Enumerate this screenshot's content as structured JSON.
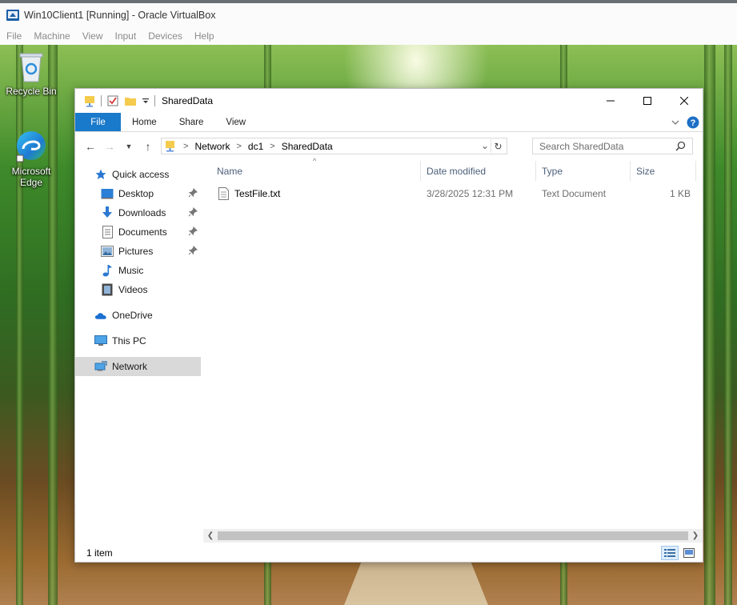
{
  "vbox": {
    "title": "Win10Client1 [Running] - Oracle VirtualBox",
    "menu": [
      "File",
      "Machine",
      "View",
      "Input",
      "Devices",
      "Help"
    ]
  },
  "desktop": {
    "icons": [
      {
        "label": "Recycle Bin",
        "icon": "recycle-bin-icon"
      },
      {
        "label": "Microsoft Edge",
        "icon": "edge-icon"
      }
    ]
  },
  "explorer": {
    "title": "SharedData",
    "ribbon_tabs": [
      "File",
      "Home",
      "Share",
      "View"
    ],
    "breadcrumb": [
      "Network",
      "dc1",
      "SharedData"
    ],
    "search_placeholder": "Search SharedData",
    "nav": {
      "quick_access": "Quick access",
      "quick_items": [
        {
          "label": "Desktop",
          "icon": "desktop-icon",
          "pinned": true
        },
        {
          "label": "Downloads",
          "icon": "downloads-icon",
          "pinned": true
        },
        {
          "label": "Documents",
          "icon": "documents-icon",
          "pinned": true
        },
        {
          "label": "Pictures",
          "icon": "pictures-icon",
          "pinned": true
        },
        {
          "label": "Music",
          "icon": "music-icon",
          "pinned": false
        },
        {
          "label": "Videos",
          "icon": "videos-icon",
          "pinned": false
        }
      ],
      "onedrive": "OneDrive",
      "this_pc": "This PC",
      "network": "Network",
      "selected": "Network"
    },
    "columns": [
      "Name",
      "Date modified",
      "Type",
      "Size"
    ],
    "files": [
      {
        "name": "TestFile.txt",
        "date_modified": "3/28/2025 12:31 PM",
        "type": "Text Document",
        "size": "1 KB"
      }
    ],
    "status": "1 item",
    "colors": {
      "file_tab": "#1979ca",
      "selected_nav": "#d9d9d9",
      "column_header": "#4c607a"
    }
  }
}
